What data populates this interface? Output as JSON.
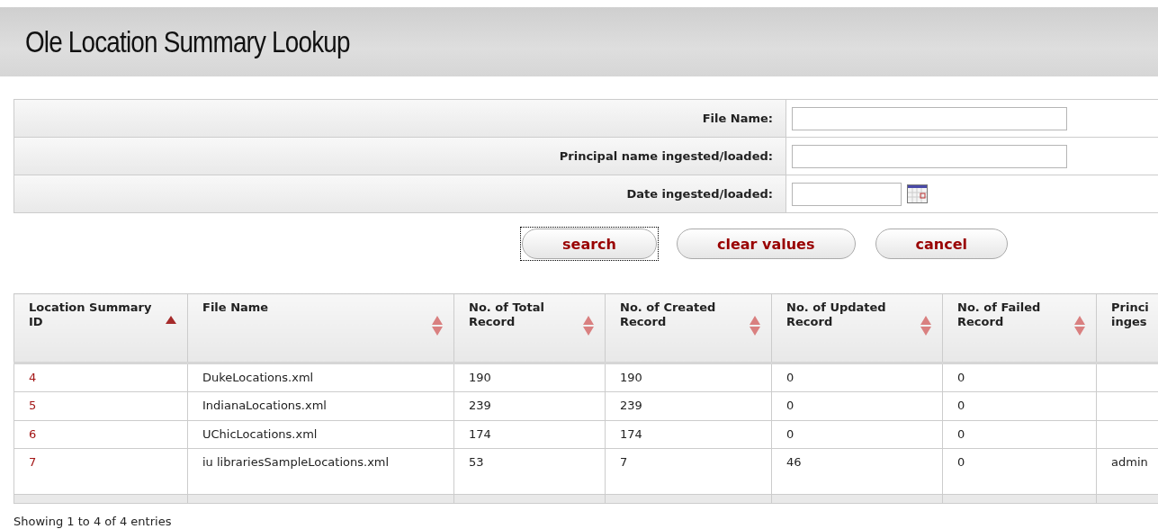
{
  "title": "Ole Location Summary Lookup",
  "search_form": {
    "fields": [
      {
        "label": "File Name:",
        "kind": "text"
      },
      {
        "label": "Principal name ingested/loaded:",
        "kind": "text"
      },
      {
        "label": "Date ingested/loaded:",
        "kind": "date"
      }
    ]
  },
  "buttons": [
    {
      "label": "search",
      "focused": true
    },
    {
      "label": "clear values",
      "focused": false
    },
    {
      "label": "cancel",
      "focused": false
    }
  ],
  "table": {
    "columns": [
      {
        "label": "Location Summary ID",
        "sorted": true
      },
      {
        "label": "File Name",
        "sorted": false
      },
      {
        "label": "No. of Total Record",
        "sorted": false
      },
      {
        "label": "No. of Created Record",
        "sorted": false
      },
      {
        "label": "No. of Updated Record",
        "sorted": false
      },
      {
        "label": "No. of Failed Record",
        "sorted": false
      },
      {
        "label": "Princi inges"
      }
    ],
    "rows": [
      [
        "4",
        "DukeLocations.xml",
        "190",
        "190",
        "0",
        "0",
        ""
      ],
      [
        "5",
        "IndianaLocations.xml",
        "239",
        "239",
        "0",
        "0",
        ""
      ],
      [
        "6",
        "UChicLocations.xml",
        "174",
        "174",
        "0",
        "0",
        ""
      ],
      [
        "7",
        "iu librariesSampleLocations.xml",
        "53",
        "7",
        "46",
        "0",
        "admin"
      ]
    ]
  },
  "status": "Showing 1 to 4 of 4 entries"
}
